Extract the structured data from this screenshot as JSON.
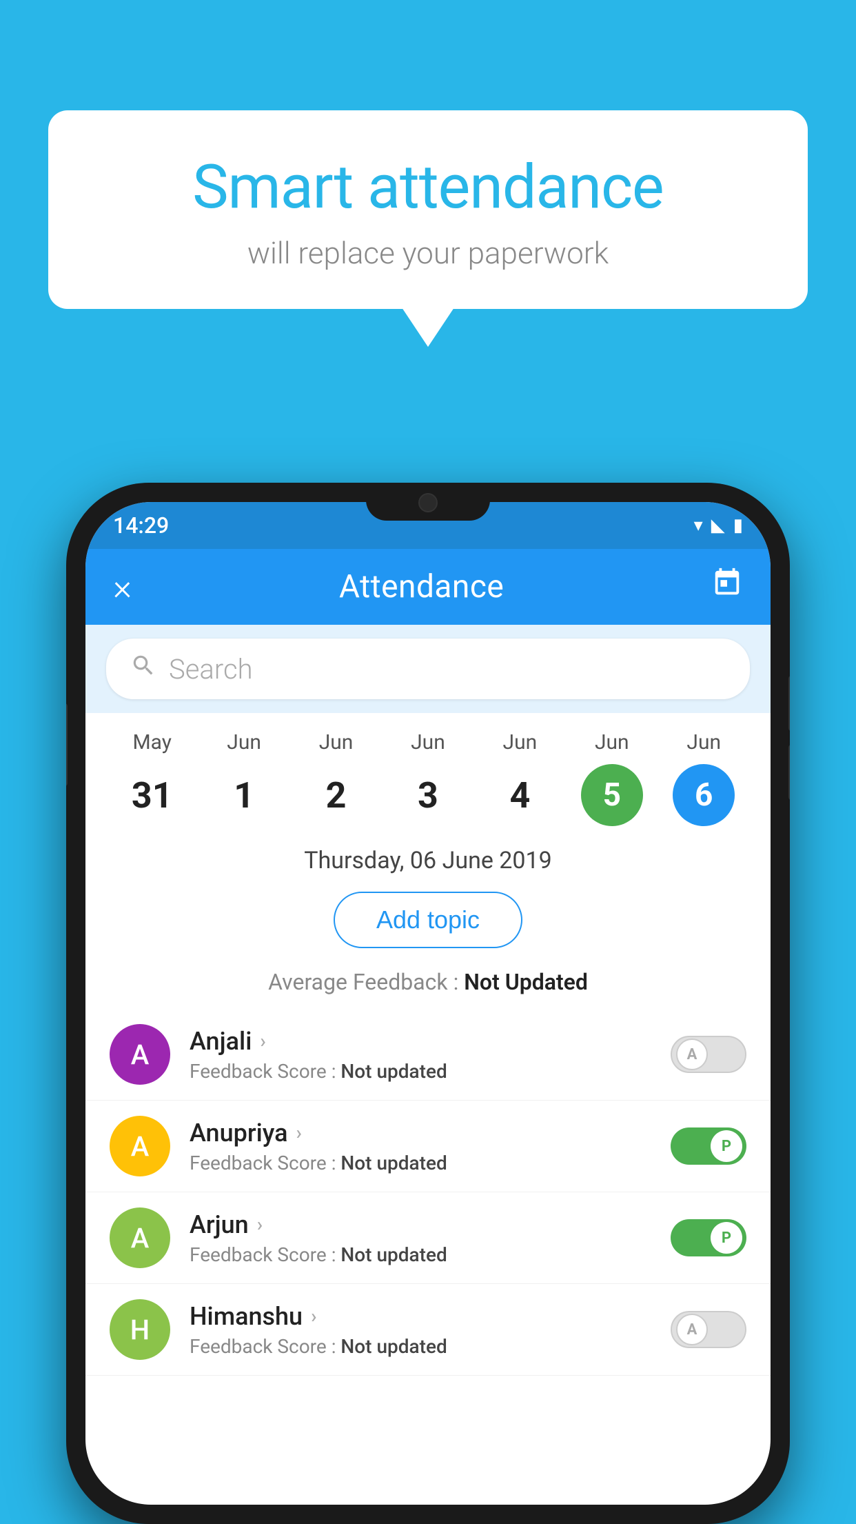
{
  "background_color": "#29B6E8",
  "bubble": {
    "title": "Smart attendance",
    "subtitle": "will replace your paperwork"
  },
  "app": {
    "title": "Attendance",
    "close_label": "×",
    "calendar_icon": "📅"
  },
  "status_bar": {
    "time": "14:29"
  },
  "search": {
    "placeholder": "Search"
  },
  "calendar": {
    "days": [
      {
        "month": "May",
        "date": "31",
        "type": "normal"
      },
      {
        "month": "Jun",
        "date": "1",
        "type": "normal"
      },
      {
        "month": "Jun",
        "date": "2",
        "type": "normal"
      },
      {
        "month": "Jun",
        "date": "3",
        "type": "normal"
      },
      {
        "month": "Jun",
        "date": "4",
        "type": "normal"
      },
      {
        "month": "Jun",
        "date": "5",
        "type": "today"
      },
      {
        "month": "Jun",
        "date": "6",
        "type": "selected"
      }
    ],
    "selected_date_label": "Thursday, 06 June 2019"
  },
  "add_topic_label": "Add topic",
  "average_feedback": {
    "label": "Average Feedback : ",
    "value": "Not Updated"
  },
  "students": [
    {
      "name": "Anjali",
      "avatar_color": "#9C27B0",
      "avatar_letter": "A",
      "feedback_label": "Feedback Score : ",
      "feedback_value": "Not updated",
      "attendance": "absent",
      "toggle_letter": "A"
    },
    {
      "name": "Anupriya",
      "avatar_color": "#FFC107",
      "avatar_letter": "A",
      "feedback_label": "Feedback Score : ",
      "feedback_value": "Not updated",
      "attendance": "present",
      "toggle_letter": "P"
    },
    {
      "name": "Arjun",
      "avatar_color": "#8BC34A",
      "avatar_letter": "A",
      "feedback_label": "Feedback Score : ",
      "feedback_value": "Not updated",
      "attendance": "present",
      "toggle_letter": "P"
    },
    {
      "name": "Himanshu",
      "avatar_color": "#8BC34A",
      "avatar_letter": "H",
      "feedback_label": "Feedback Score : ",
      "feedback_value": "Not updated",
      "attendance": "absent",
      "toggle_letter": "A"
    }
  ]
}
